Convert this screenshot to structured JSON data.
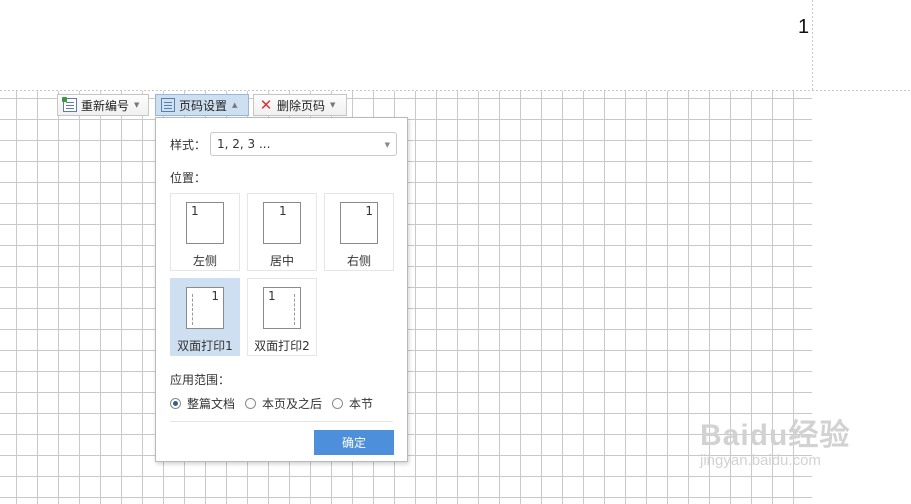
{
  "header": {
    "page_number": "1"
  },
  "toolbar": {
    "renumber_label": "重新编号",
    "page_settings_label": "页码设置",
    "delete_label": "删除页码"
  },
  "panel": {
    "style_label": "样式：",
    "style_value": "1, 2, 3 ...",
    "position_label": "位置：",
    "positions": [
      {
        "caption": "左侧",
        "number": "1"
      },
      {
        "caption": "居中",
        "number": "1"
      },
      {
        "caption": "右侧",
        "number": "1"
      },
      {
        "caption": "双面打印1",
        "number": "1",
        "selected": true
      },
      {
        "caption": "双面打印2",
        "number": "1"
      }
    ],
    "range_label": "应用范围：",
    "range_options": [
      "整篇文档",
      "本页及之后",
      "本节"
    ],
    "range_selected": "整篇文档",
    "ok_label": "确定"
  },
  "watermark": {
    "main": "Baidu经验",
    "sub": "jingyan.baidu.com"
  },
  "colors": {
    "accent": "#4d8fdb",
    "selected_tile": "#cfdff2",
    "grid_line": "#c9c9c9"
  }
}
